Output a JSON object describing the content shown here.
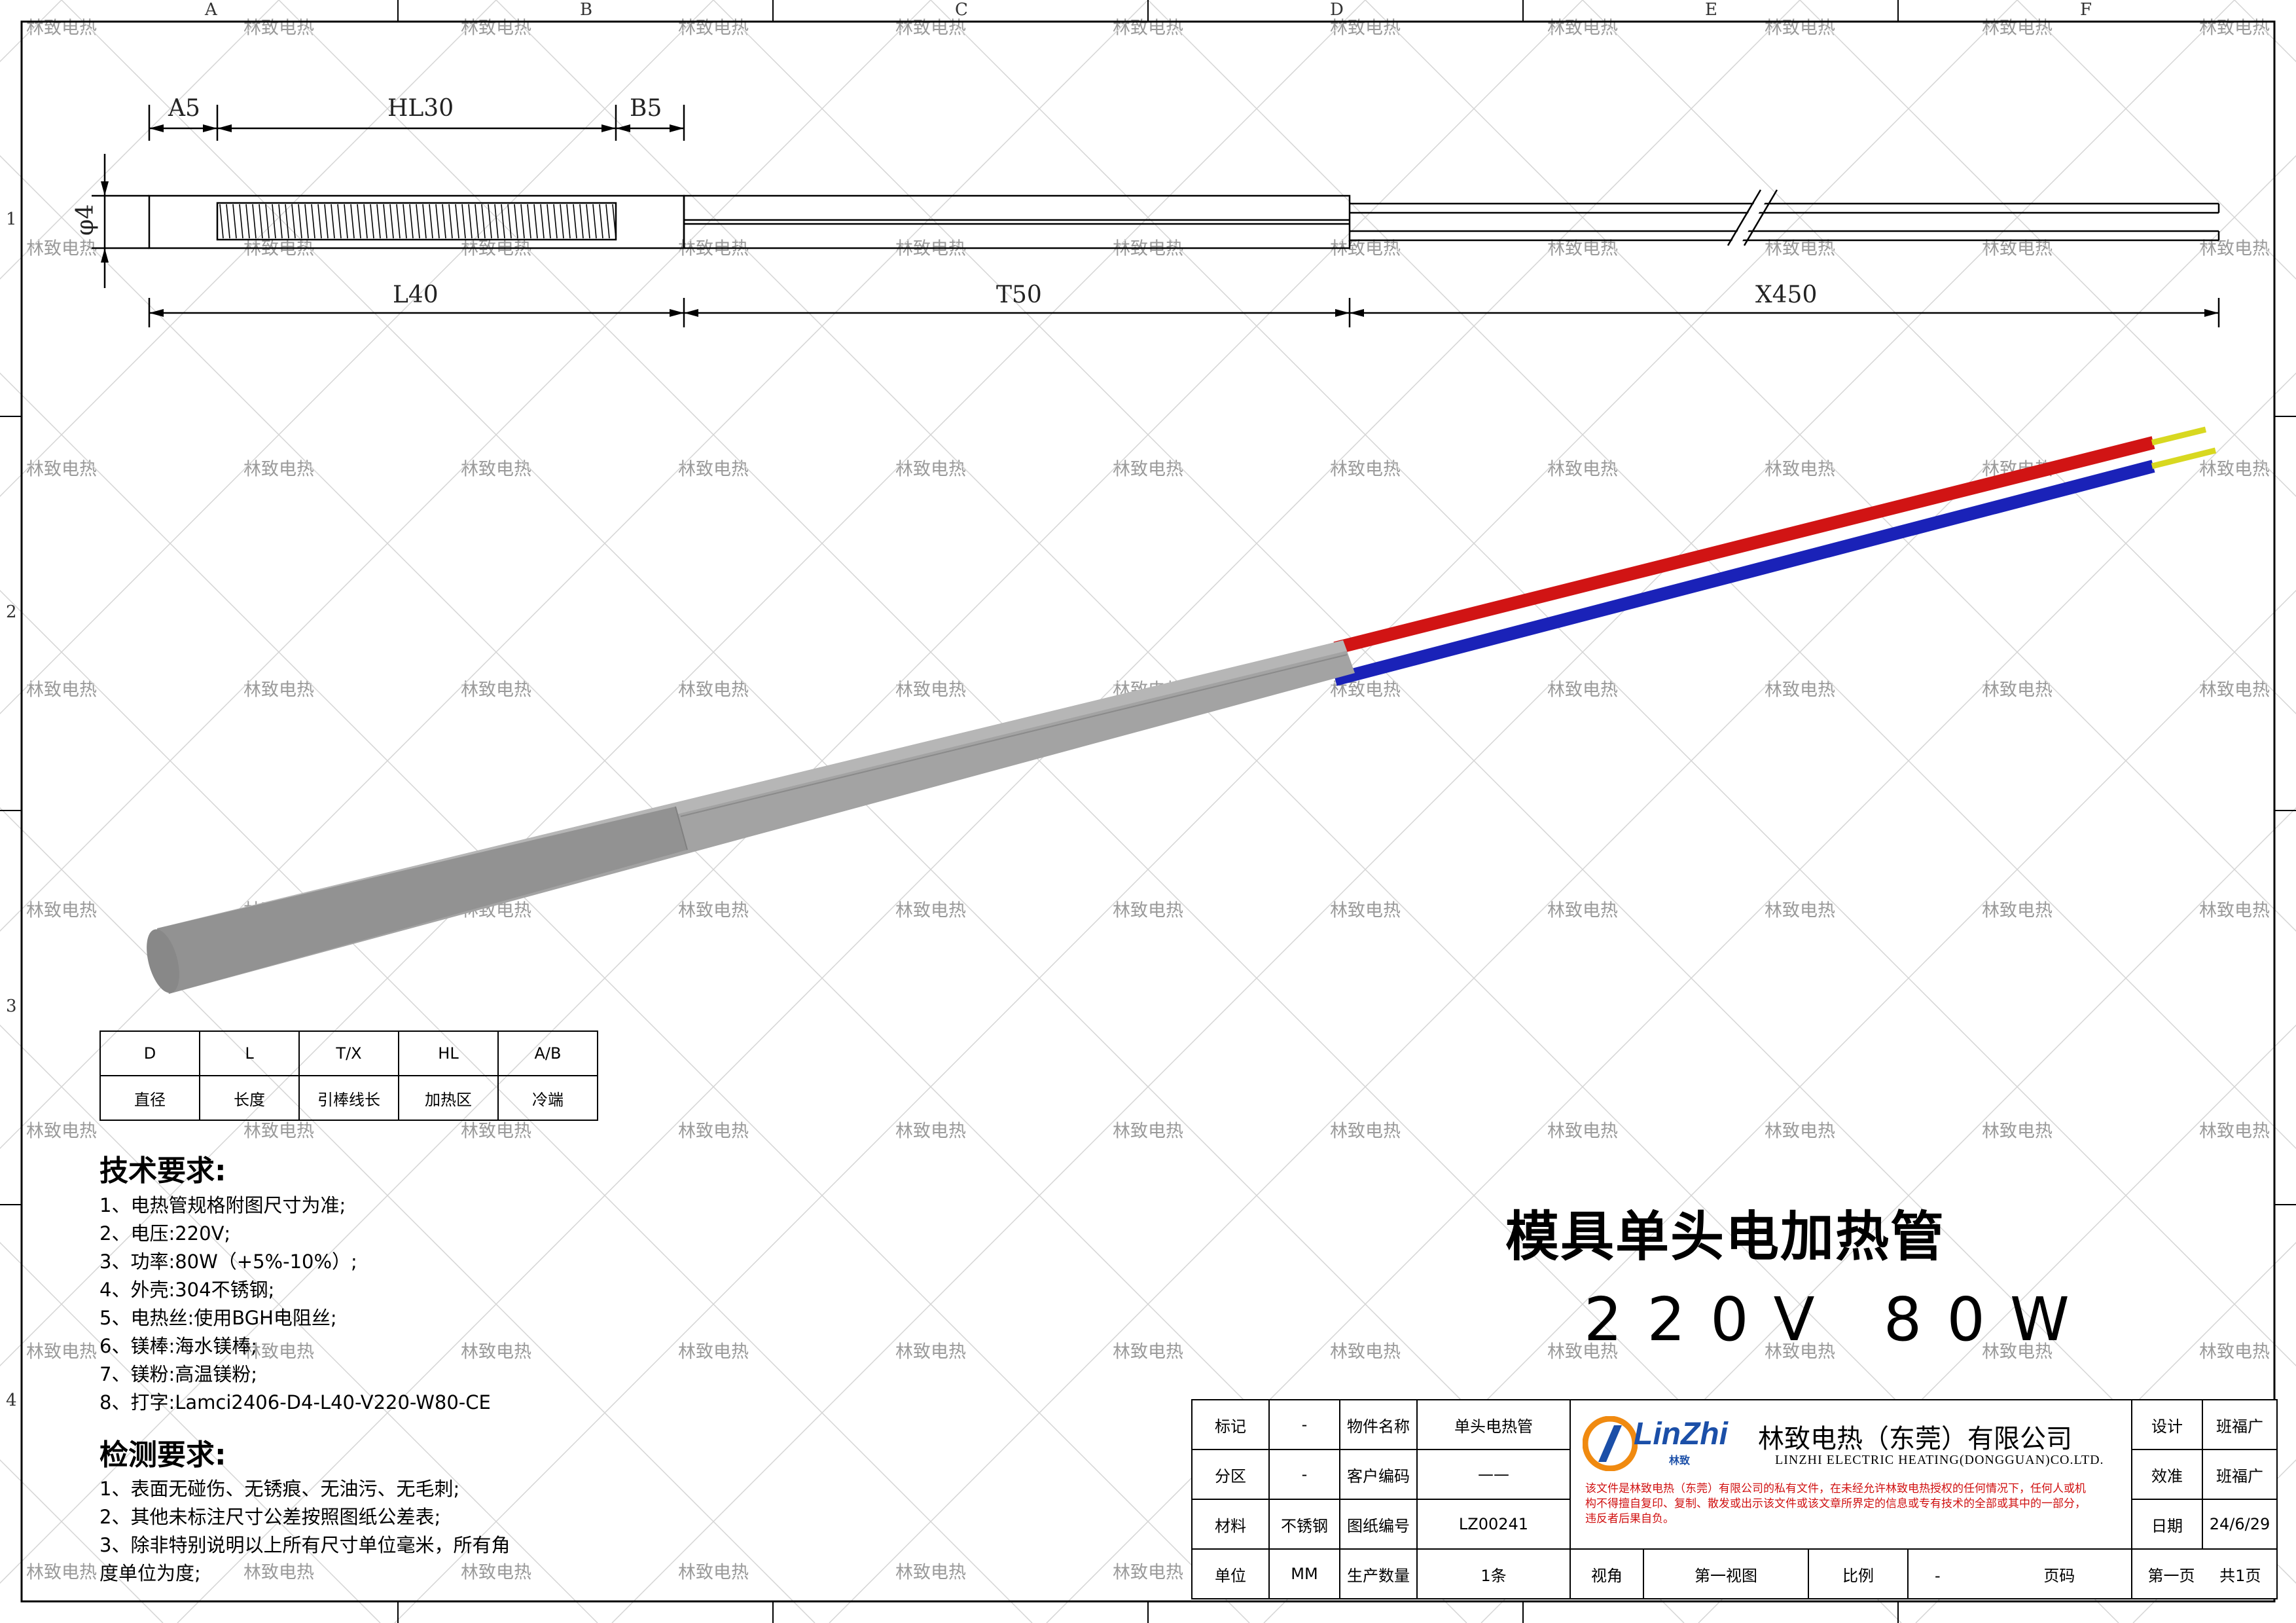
{
  "watermark": "林致电热",
  "zones": {
    "columns": [
      "A",
      "B",
      "C",
      "D",
      "E",
      "F"
    ],
    "rows": [
      "1",
      "2",
      "3",
      "4"
    ]
  },
  "dimensions": {
    "a": "A5",
    "hl": "HL30",
    "b": "B5",
    "diameter": "φ4",
    "l": "L40",
    "t": "T50",
    "x": "X450"
  },
  "spec_table": {
    "headers": [
      "D",
      "L",
      "T/X",
      "HL",
      "A/B"
    ],
    "values": [
      "直径",
      "长度",
      "引棒线长",
      "加热区",
      "冷端"
    ]
  },
  "tech_requirements": {
    "title": "技术要求:",
    "lines": [
      "1、电热管规格附图尺寸为准;",
      "2、电压:220V;",
      "3、功率:80W（+5%-10%）;",
      "4、外壳:304不锈钢;",
      "5、电热丝:使用BGH电阻丝;",
      "6、镁棒:海水镁棒;",
      "7、镁粉:高温镁粉;",
      "8、打字:Lamci2406-D4-L40-V220-W80-CE"
    ]
  },
  "inspection_requirements": {
    "title": "检测要求:",
    "lines": [
      "1、表面无碰伤、无锈痕、无油污、无毛刺;",
      "2、其他未标注尺寸公差按照图纸公差表;",
      "3、除非特别说明以上所有尺寸单位毫米，所有角",
      "度单位为度;"
    ]
  },
  "product_title": "模具单头电加热管",
  "product_subtitle": "220V 80W",
  "title_block": {
    "mark_label": "标记",
    "mark_value": "-",
    "part_name_label": "物件名称",
    "part_name_value": "单头电热管",
    "zone_label": "分区",
    "zone_value": "-",
    "customer_code_label": "客户编码",
    "customer_code_value": "——",
    "material_label": "材料",
    "material_value": "不锈钢",
    "drawing_no_label": "图纸编号",
    "drawing_no_value": "LZ00241",
    "unit_label": "单位",
    "unit_value": "MM",
    "quantity_label": "生产数量",
    "quantity_value": "1条",
    "view_label": "视角",
    "view_value": "第一视图",
    "scale_label": "比例",
    "scale_value": "-",
    "page_label": "页码",
    "page_value": "第一页",
    "total_pages": "共1页",
    "design_label": "设计",
    "design_value": "班福广",
    "check_label": "效准",
    "check_value": "班福广",
    "date_label": "日期",
    "date_value": "24/6/29",
    "logo_text": "LinZhi",
    "logo_sub": "林致",
    "company_cn": "林致电热（东莞）有限公司",
    "company_en": "LINZHI ELECTRIC HEATING(DONGGUAN)CO.LTD.",
    "notice": "该文件是林致电热（东莞）有限公司的私有文件，在未经允许林致电热授权的任何情况下，任何人或机构不得擅自复印、复制、散发或出示该文件或该文章所界定的信息或专有技术的全部或其中的一部分，违反者后果自负。"
  },
  "colors": {
    "red_wire": "#d11414",
    "blue_wire": "#1a22b8",
    "wire_tip": "#d8d820",
    "tube": "#a0a0a0",
    "notice_red": "#d01010",
    "logo_orange": "#f08a10",
    "logo_blue": "#1b4fa8"
  }
}
